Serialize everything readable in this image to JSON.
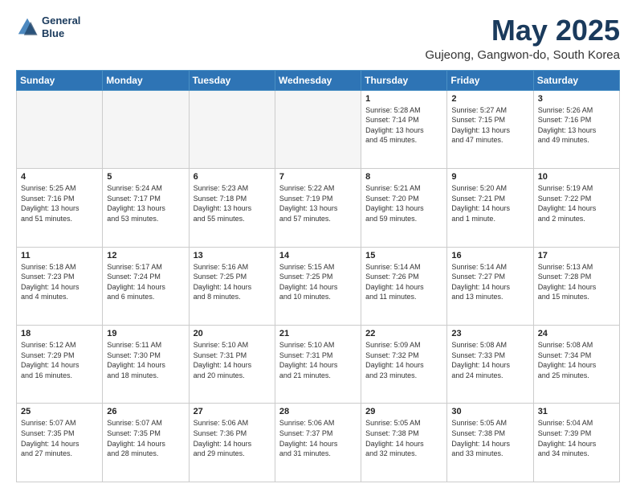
{
  "header": {
    "logo_line1": "General",
    "logo_line2": "Blue",
    "month_title": "May 2025",
    "location": "Gujeong, Gangwon-do, South Korea"
  },
  "weekdays": [
    "Sunday",
    "Monday",
    "Tuesday",
    "Wednesday",
    "Thursday",
    "Friday",
    "Saturday"
  ],
  "weeks": [
    [
      {
        "day": "",
        "info": ""
      },
      {
        "day": "",
        "info": ""
      },
      {
        "day": "",
        "info": ""
      },
      {
        "day": "",
        "info": ""
      },
      {
        "day": "1",
        "info": "Sunrise: 5:28 AM\nSunset: 7:14 PM\nDaylight: 13 hours\nand 45 minutes."
      },
      {
        "day": "2",
        "info": "Sunrise: 5:27 AM\nSunset: 7:15 PM\nDaylight: 13 hours\nand 47 minutes."
      },
      {
        "day": "3",
        "info": "Sunrise: 5:26 AM\nSunset: 7:16 PM\nDaylight: 13 hours\nand 49 minutes."
      }
    ],
    [
      {
        "day": "4",
        "info": "Sunrise: 5:25 AM\nSunset: 7:16 PM\nDaylight: 13 hours\nand 51 minutes."
      },
      {
        "day": "5",
        "info": "Sunrise: 5:24 AM\nSunset: 7:17 PM\nDaylight: 13 hours\nand 53 minutes."
      },
      {
        "day": "6",
        "info": "Sunrise: 5:23 AM\nSunset: 7:18 PM\nDaylight: 13 hours\nand 55 minutes."
      },
      {
        "day": "7",
        "info": "Sunrise: 5:22 AM\nSunset: 7:19 PM\nDaylight: 13 hours\nand 57 minutes."
      },
      {
        "day": "8",
        "info": "Sunrise: 5:21 AM\nSunset: 7:20 PM\nDaylight: 13 hours\nand 59 minutes."
      },
      {
        "day": "9",
        "info": "Sunrise: 5:20 AM\nSunset: 7:21 PM\nDaylight: 14 hours\nand 1 minute."
      },
      {
        "day": "10",
        "info": "Sunrise: 5:19 AM\nSunset: 7:22 PM\nDaylight: 14 hours\nand 2 minutes."
      }
    ],
    [
      {
        "day": "11",
        "info": "Sunrise: 5:18 AM\nSunset: 7:23 PM\nDaylight: 14 hours\nand 4 minutes."
      },
      {
        "day": "12",
        "info": "Sunrise: 5:17 AM\nSunset: 7:24 PM\nDaylight: 14 hours\nand 6 minutes."
      },
      {
        "day": "13",
        "info": "Sunrise: 5:16 AM\nSunset: 7:25 PM\nDaylight: 14 hours\nand 8 minutes."
      },
      {
        "day": "14",
        "info": "Sunrise: 5:15 AM\nSunset: 7:25 PM\nDaylight: 14 hours\nand 10 minutes."
      },
      {
        "day": "15",
        "info": "Sunrise: 5:14 AM\nSunset: 7:26 PM\nDaylight: 14 hours\nand 11 minutes."
      },
      {
        "day": "16",
        "info": "Sunrise: 5:14 AM\nSunset: 7:27 PM\nDaylight: 14 hours\nand 13 minutes."
      },
      {
        "day": "17",
        "info": "Sunrise: 5:13 AM\nSunset: 7:28 PM\nDaylight: 14 hours\nand 15 minutes."
      }
    ],
    [
      {
        "day": "18",
        "info": "Sunrise: 5:12 AM\nSunset: 7:29 PM\nDaylight: 14 hours\nand 16 minutes."
      },
      {
        "day": "19",
        "info": "Sunrise: 5:11 AM\nSunset: 7:30 PM\nDaylight: 14 hours\nand 18 minutes."
      },
      {
        "day": "20",
        "info": "Sunrise: 5:10 AM\nSunset: 7:31 PM\nDaylight: 14 hours\nand 20 minutes."
      },
      {
        "day": "21",
        "info": "Sunrise: 5:10 AM\nSunset: 7:31 PM\nDaylight: 14 hours\nand 21 minutes."
      },
      {
        "day": "22",
        "info": "Sunrise: 5:09 AM\nSunset: 7:32 PM\nDaylight: 14 hours\nand 23 minutes."
      },
      {
        "day": "23",
        "info": "Sunrise: 5:08 AM\nSunset: 7:33 PM\nDaylight: 14 hours\nand 24 minutes."
      },
      {
        "day": "24",
        "info": "Sunrise: 5:08 AM\nSunset: 7:34 PM\nDaylight: 14 hours\nand 25 minutes."
      }
    ],
    [
      {
        "day": "25",
        "info": "Sunrise: 5:07 AM\nSunset: 7:35 PM\nDaylight: 14 hours\nand 27 minutes."
      },
      {
        "day": "26",
        "info": "Sunrise: 5:07 AM\nSunset: 7:35 PM\nDaylight: 14 hours\nand 28 minutes."
      },
      {
        "day": "27",
        "info": "Sunrise: 5:06 AM\nSunset: 7:36 PM\nDaylight: 14 hours\nand 29 minutes."
      },
      {
        "day": "28",
        "info": "Sunrise: 5:06 AM\nSunset: 7:37 PM\nDaylight: 14 hours\nand 31 minutes."
      },
      {
        "day": "29",
        "info": "Sunrise: 5:05 AM\nSunset: 7:38 PM\nDaylight: 14 hours\nand 32 minutes."
      },
      {
        "day": "30",
        "info": "Sunrise: 5:05 AM\nSunset: 7:38 PM\nDaylight: 14 hours\nand 33 minutes."
      },
      {
        "day": "31",
        "info": "Sunrise: 5:04 AM\nSunset: 7:39 PM\nDaylight: 14 hours\nand 34 minutes."
      }
    ]
  ]
}
